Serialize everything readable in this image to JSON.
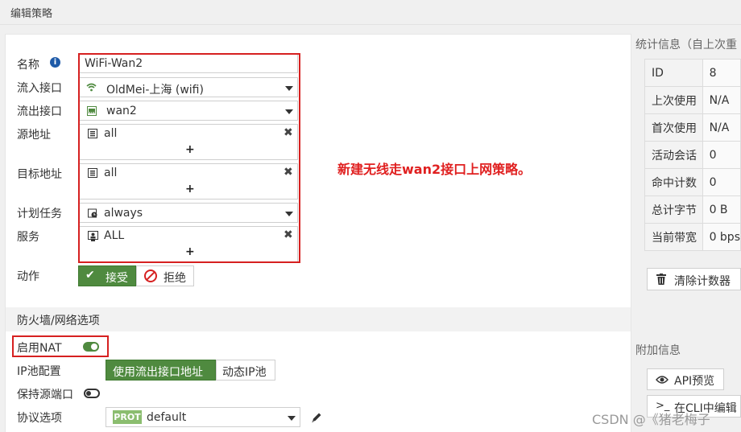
{
  "page": {
    "title": "编辑策略"
  },
  "form": {
    "name": {
      "label": "名称",
      "value": "WiFi-Wan2"
    },
    "incoming": {
      "label": "流入接口",
      "value": "OldMei-上海 (wifi)"
    },
    "outgoing": {
      "label": "流出接口",
      "value": "wan2"
    },
    "source": {
      "label": "源地址",
      "value": "all",
      "add": "+"
    },
    "destination": {
      "label": "目标地址",
      "value": "all",
      "add": "+"
    },
    "schedule": {
      "label": "计划任务",
      "value": "always"
    },
    "service": {
      "label": "服务",
      "value": "ALL",
      "add": "+"
    },
    "action": {
      "label": "动作",
      "accept": "接受",
      "deny": "拒绝"
    }
  },
  "firewall": {
    "section_title": "防火墙/网络选项",
    "nat": {
      "label": "启用NAT",
      "enabled": true
    },
    "ip_pool": {
      "label": "IP池配置",
      "option_active": "使用流出接口地址",
      "option_dynamic": "动态IP池"
    },
    "preserve_port": {
      "label": "保持源端口",
      "enabled": false
    },
    "protocol": {
      "label": "协议选项",
      "badge": "PROT",
      "value": "default"
    }
  },
  "annotation": "新建无线走wan2接口上网策略。",
  "stats": {
    "title": "统计信息（自上次重",
    "rows": [
      {
        "key": "ID",
        "value": "8"
      },
      {
        "key": "上次使用",
        "value": "N/A"
      },
      {
        "key": "首次使用",
        "value": "N/A"
      },
      {
        "key": "活动会话",
        "value": "0"
      },
      {
        "key": "命中计数",
        "value": "0"
      },
      {
        "key": "总计字节",
        "value": "0 B"
      },
      {
        "key": "当前带宽",
        "value": "0 bps"
      }
    ],
    "clear_button": "清除计数器"
  },
  "extra": {
    "title": "附加信息",
    "api_preview": "API预览",
    "cli_edit": "在CLI中编辑"
  },
  "watermark": "CSDN @《猪老梅子",
  "colors": {
    "accent_green": "#4f8a3f",
    "annotation_red": "#e02020",
    "info_blue": "#1e5aa8"
  }
}
